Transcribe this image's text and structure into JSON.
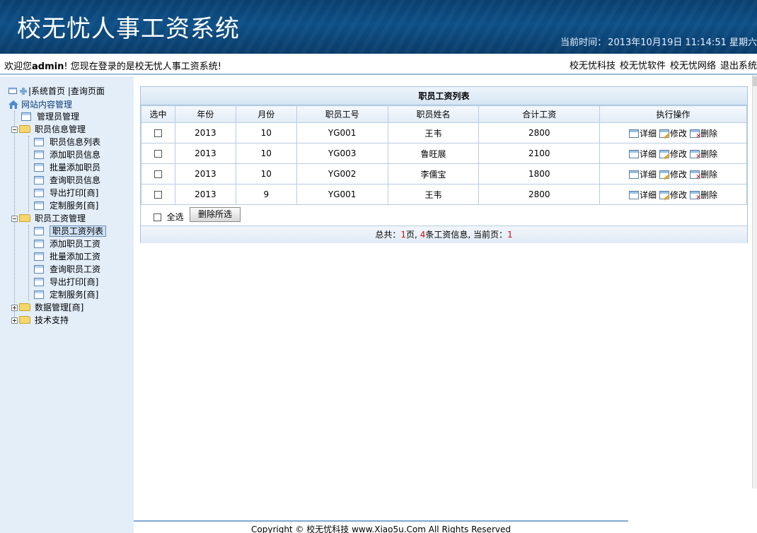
{
  "header": {
    "title": "校无忧人事工资系统",
    "time_label": "当前时间：",
    "time_value": "2013年10月19日  11:14:51 星期六"
  },
  "infobar": {
    "welcome_prefix": "欢迎您",
    "username": "admin",
    "welcome_suffix": "! 您现在登录的是校无忧人事工资系统!",
    "links": [
      "校无忧科技",
      "校无忧软件",
      "校无忧网络",
      "退出系统"
    ]
  },
  "sidebar": {
    "top_links": [
      "|系统首页",
      "|查询页面"
    ],
    "root": "网站内容管理",
    "admin_item": "管理员管理",
    "groups": [
      {
        "label": "职员信息管理",
        "expanded": true,
        "items": [
          "职员信息列表",
          "添加职员信息",
          "批量添加职员",
          "查询职员信息",
          "导出打印[商]",
          "定制服务[商]"
        ]
      },
      {
        "label": "职员工资管理",
        "expanded": true,
        "items": [
          "职员工资列表",
          "添加职员工资",
          "批量添加工资",
          "查询职员工资",
          "导出打印[商]",
          "定制服务[商]"
        ]
      },
      {
        "label": "数据管理[商]",
        "expanded": false,
        "items": []
      },
      {
        "label": "技术支持",
        "expanded": false,
        "items": []
      }
    ],
    "selected": "职员工资列表"
  },
  "panel": {
    "caption": "职员工资列表",
    "columns": [
      "选中",
      "年份",
      "月份",
      "职员工号",
      "职员姓名",
      "合计工资",
      "执行操作"
    ],
    "rows": [
      {
        "year": "2013",
        "month": "10",
        "id": "YG001",
        "name": "王韦",
        "total": "2800"
      },
      {
        "year": "2013",
        "month": "10",
        "id": "YG003",
        "name": "鲁旺展",
        "total": "2100"
      },
      {
        "year": "2013",
        "month": "10",
        "id": "YG002",
        "name": "李儒宝",
        "total": "1800"
      },
      {
        "year": "2013",
        "month": "9",
        "id": "YG001",
        "name": "王韦",
        "total": "2800"
      }
    ],
    "ops": {
      "detail": "详细",
      "edit": "修改",
      "delete": "删除"
    },
    "select_all": "全选",
    "delete_selected": "删除所选",
    "pager": {
      "prefix": "总共：",
      "pages": "1",
      "mid1": "页, ",
      "count": "4",
      "mid2": "条工资信息, 当前页：",
      "current": "1"
    }
  },
  "footer": {
    "text": "Copyright © 校无忧科技  www.Xiao5u.Com All Rights Reserved"
  }
}
